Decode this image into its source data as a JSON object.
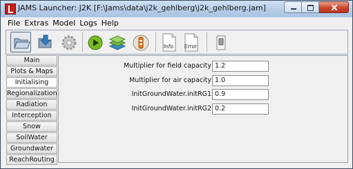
{
  "window": {
    "title": "JAMS Launcher: J2K [F:\\Jams\\data\\j2k_gehlberg\\j2k_gehlberg.jam]"
  },
  "menu": [
    "File",
    "Extras",
    "Model",
    "Logs",
    "Help"
  ],
  "toolbar": {
    "buttons": [
      {
        "name": "open-folder-icon"
      },
      {
        "name": "save-icon"
      },
      {
        "name": "settings-gear-icon"
      },
      {
        "name": "run-model-icon"
      },
      {
        "name": "layers-icon"
      },
      {
        "name": "model-info-icon"
      },
      {
        "name": "info-log-icon",
        "label": "Info"
      },
      {
        "name": "error-log-icon",
        "label": "Error"
      },
      {
        "name": "toggle-switch-icon"
      }
    ]
  },
  "sidebar": {
    "items": [
      {
        "label": "Main"
      },
      {
        "label": "Plots & Maps"
      },
      {
        "label": "Initialising",
        "active": true
      },
      {
        "label": "Regionalization"
      },
      {
        "label": "Radiation"
      },
      {
        "label": "Interception"
      },
      {
        "label": "Snow"
      },
      {
        "label": "SoilWater"
      },
      {
        "label": "Groundwater"
      },
      {
        "label": "ReachRouting"
      }
    ]
  },
  "fields": [
    {
      "label": "Multiplier for field capacity",
      "value": "1.2"
    },
    {
      "label": "Multiplier for air capacity",
      "value": "1.0"
    },
    {
      "label": "InitGroundWater.initRG1",
      "value": "0.9"
    },
    {
      "label": "InitGroundWater.initRG2",
      "value": "0.2"
    }
  ]
}
